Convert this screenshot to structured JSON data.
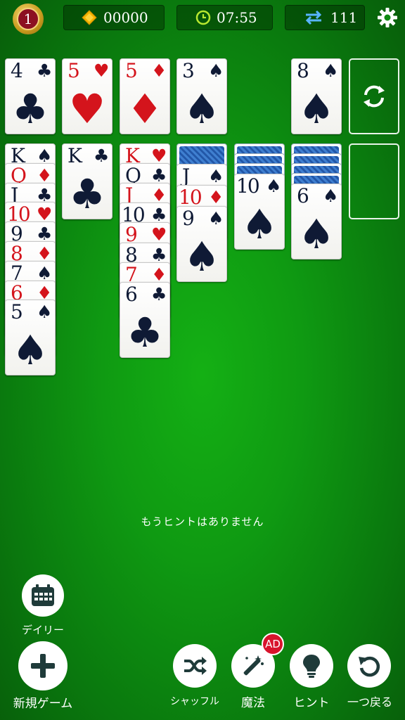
{
  "hud": {
    "level": "1",
    "gems": "00000",
    "timer": "07:55",
    "moves": "111",
    "icons": [
      "diamond-icon",
      "clock-icon",
      "swap-arrows-icon",
      "gear-icon"
    ]
  },
  "foundations": [
    {
      "rank": "4",
      "suit": "♣",
      "color": "black"
    },
    {
      "rank": "5",
      "suit": "♥",
      "color": "red"
    },
    {
      "rank": "5",
      "suit": "♦",
      "color": "red"
    },
    {
      "rank": "3",
      "suit": "♠",
      "color": "black"
    }
  ],
  "waste": {
    "rank": "8",
    "suit": "♠",
    "color": "black"
  },
  "tableau": {
    "col1": [
      "K♠",
      "Q♦",
      "J♣",
      "10♥",
      "9♣",
      "8♦",
      "7♠",
      "6♦",
      "5♠"
    ],
    "col2": [
      "K♣"
    ],
    "col3": [
      "K♥",
      "Q♣",
      "J♦",
      "10♣",
      "9♥",
      "8♣",
      "7♦",
      "6♣"
    ],
    "col4_faceup": [
      "J♠",
      "10♦",
      "9♠"
    ],
    "col5_faceup": [
      "10♠"
    ],
    "col6_faceup": [
      "6♠"
    ]
  },
  "message": "もうヒントはありません",
  "buttons": {
    "daily": "デイリー",
    "new_game": "新規ゲーム",
    "shuffle": "シャッフル",
    "magic": "魔法",
    "hint": "ヒント",
    "undo": "一つ戻る",
    "ad_badge": "AD"
  },
  "colors": {
    "felt": "#0f9a12",
    "red": "#d4141c",
    "black": "#0f1a35"
  }
}
